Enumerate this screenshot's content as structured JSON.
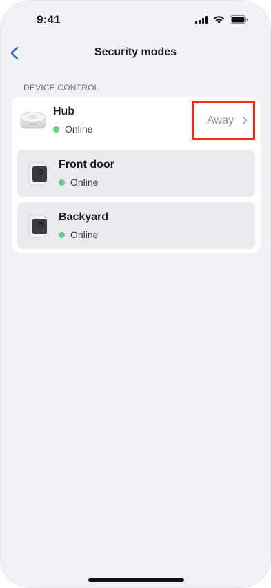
{
  "status_bar": {
    "time": "9:41",
    "icons": [
      "cellular-signal-icon",
      "wifi-icon",
      "battery-icon"
    ]
  },
  "nav": {
    "title": "Security modes",
    "back_icon": "chevron-left-icon"
  },
  "section": {
    "header": "DEVICE CONTROL"
  },
  "devices": [
    {
      "name": "Hub",
      "status": "Online",
      "icon": "hub-device-icon",
      "mode": "Away",
      "mode_icon": "chevron-right-icon"
    },
    {
      "name": "Front door",
      "status": "Online",
      "icon": "camera-device-icon"
    },
    {
      "name": "Backyard",
      "status": "Online",
      "icon": "camera-device-icon"
    }
  ],
  "colors": {
    "accent": "#1f63c9",
    "online": "#5fcf8c",
    "highlight_border": "#ee2e1b",
    "background": "#f2f1f6",
    "row_background": "#ebebef"
  }
}
